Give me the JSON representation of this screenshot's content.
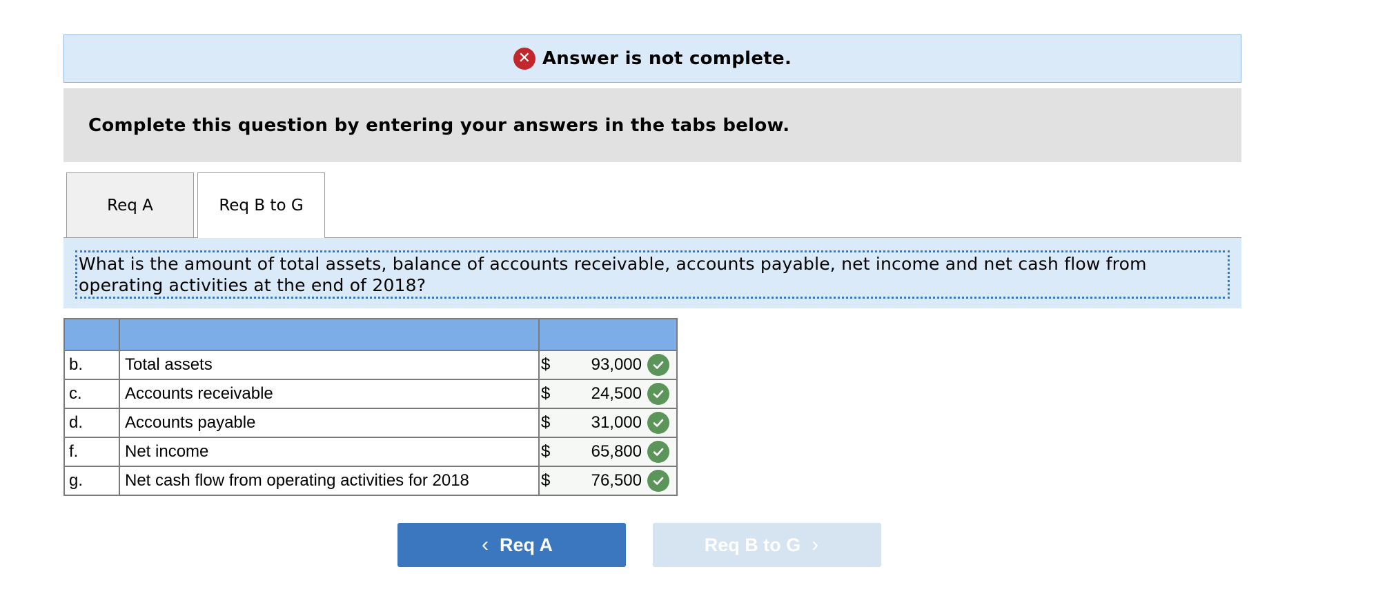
{
  "banner": {
    "status_text": "Answer is not complete.",
    "status_icon": "error-x-icon"
  },
  "instructions": {
    "text": "Complete this question by entering your answers in the tabs below."
  },
  "tabs": [
    {
      "label": "Req A",
      "active": false
    },
    {
      "label": "Req B to G",
      "active": true
    }
  ],
  "question": {
    "text": "What is the amount of total assets, balance of accounts receivable, accounts payable, net income and net cash flow from operating activities at the end of 2018?"
  },
  "table": {
    "currency_symbol": "$",
    "rows": [
      {
        "letter": "b.",
        "label": "Total assets",
        "value": "93,000",
        "status": "correct"
      },
      {
        "letter": "c.",
        "label": "Accounts receivable",
        "value": "24,500",
        "status": "correct"
      },
      {
        "letter": "d.",
        "label": "Accounts payable",
        "value": "31,000",
        "status": "correct"
      },
      {
        "letter": "f.",
        "label": "Net income",
        "value": "65,800",
        "status": "correct"
      },
      {
        "letter": "g.",
        "label": "Net cash flow from operating activities for 2018",
        "value": "76,500",
        "status": "correct"
      }
    ]
  },
  "navigation": {
    "prev_label": "Req A",
    "next_label": "Req B to G",
    "next_disabled": true
  },
  "colors": {
    "banner_bg": "#dbeaf8",
    "error": "#c1272d",
    "table_header": "#7cade6",
    "correct": "#5b955a",
    "button_primary": "#3b77bf",
    "button_disabled": "#d6e3f1"
  }
}
